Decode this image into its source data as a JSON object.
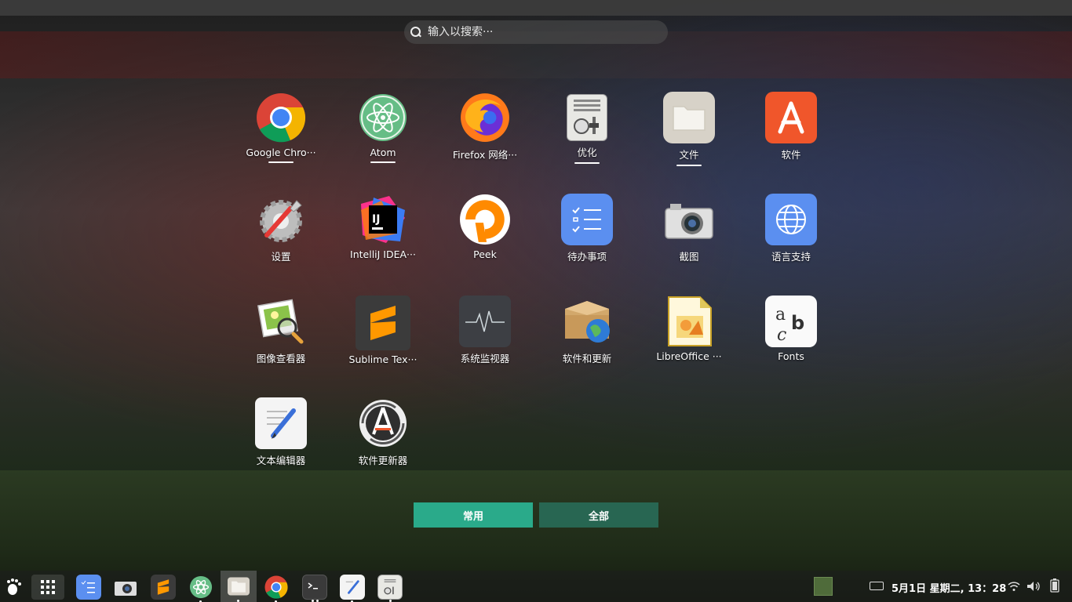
{
  "search": {
    "placeholder": "输入以搜索···"
  },
  "apps": [
    {
      "name": "app-google-chrome",
      "label": "Google Chro···",
      "icon": "chrome-icon",
      "running": true
    },
    {
      "name": "app-atom",
      "label": "Atom",
      "icon": "atom-icon",
      "running": true
    },
    {
      "name": "app-firefox",
      "label": "Firefox 网络···",
      "icon": "firefox-icon",
      "running": false
    },
    {
      "name": "app-tweaks",
      "label": "优化",
      "icon": "tweaks-icon",
      "running": true
    },
    {
      "name": "app-files",
      "label": "文件",
      "icon": "folder-icon",
      "running": true
    },
    {
      "name": "app-software",
      "label": "软件",
      "icon": "software-center-icon",
      "running": false
    },
    {
      "name": "app-settings",
      "label": "设置",
      "icon": "settings-icon",
      "running": false
    },
    {
      "name": "app-intellij",
      "label": "IntelliJ IDEA···",
      "icon": "intellij-icon",
      "running": false
    },
    {
      "name": "app-peek",
      "label": "Peek",
      "icon": "peek-icon",
      "running": false
    },
    {
      "name": "app-todo",
      "label": "待办事项",
      "icon": "todo-icon",
      "running": false
    },
    {
      "name": "app-screenshot",
      "label": "截图",
      "icon": "camera-icon",
      "running": false
    },
    {
      "name": "app-language",
      "label": "语言支持",
      "icon": "globe-icon",
      "running": false
    },
    {
      "name": "app-image-viewer",
      "label": "图像查看器",
      "icon": "image-viewer-icon",
      "running": false
    },
    {
      "name": "app-sublime",
      "label": "Sublime Tex···",
      "icon": "sublime-icon",
      "running": false
    },
    {
      "name": "app-system-monitor",
      "label": "系统监视器",
      "icon": "system-monitor-icon",
      "running": false
    },
    {
      "name": "app-software-updates",
      "label": "软件和更新",
      "icon": "package-globe-icon",
      "running": false
    },
    {
      "name": "app-libreoffice",
      "label": "LibreOffice ···",
      "icon": "libreoffice-impress-icon",
      "running": false
    },
    {
      "name": "app-fonts",
      "label": "Fonts",
      "icon": "fonts-icon",
      "running": false
    },
    {
      "name": "app-text-editor",
      "label": "文本编辑器",
      "icon": "text-editor-icon",
      "running": false
    },
    {
      "name": "app-software-updater",
      "label": "软件更新器",
      "icon": "software-updater-icon",
      "running": false
    }
  ],
  "tabs": {
    "common": "常用",
    "all": "全部"
  },
  "clock": "5月1日 星期二, 13：28",
  "colors": {
    "accent": "#2aaa8a"
  }
}
